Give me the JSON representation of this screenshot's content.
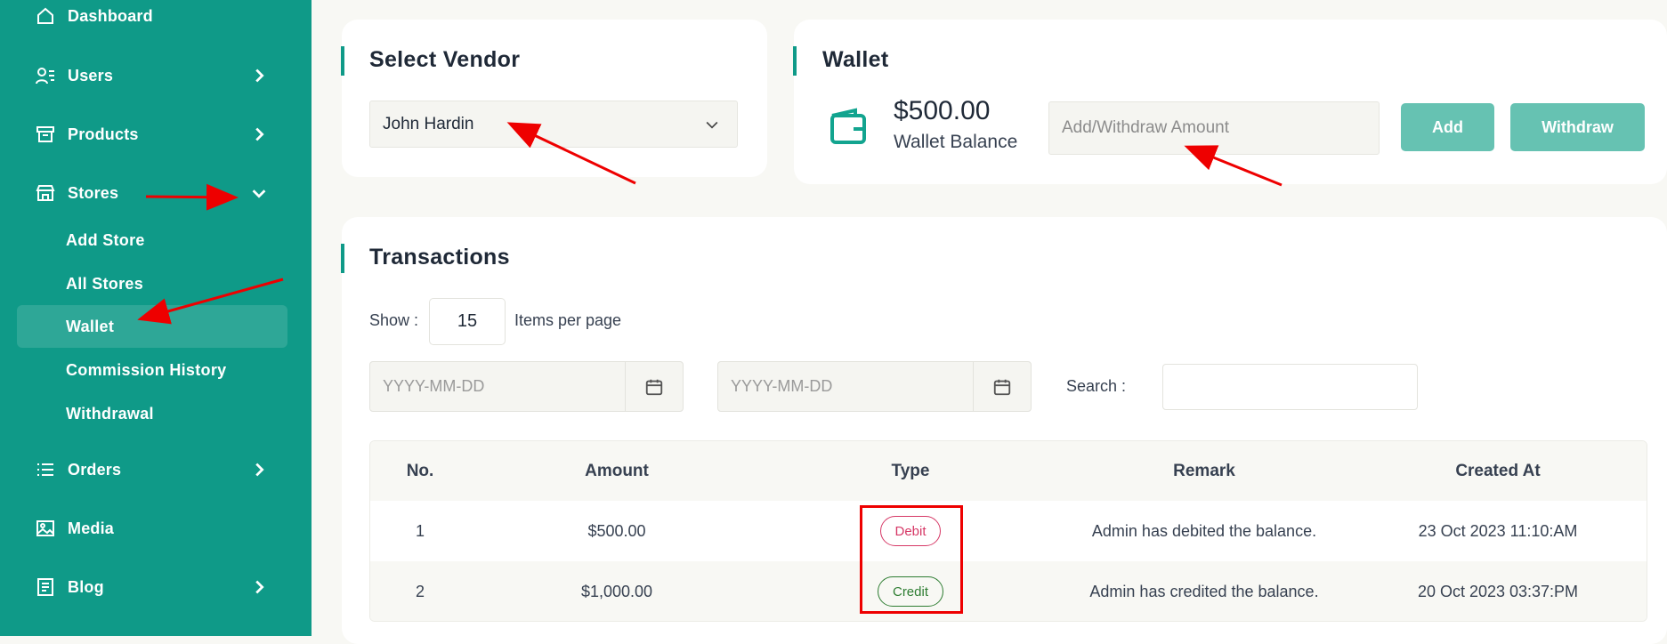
{
  "sidebar": {
    "items": [
      {
        "label": "Dashboard",
        "icon": "home-icon"
      },
      {
        "label": "Users",
        "icon": "users-icon"
      },
      {
        "label": "Products",
        "icon": "products-icon"
      },
      {
        "label": "Stores",
        "icon": "store-icon"
      },
      {
        "label": "Orders",
        "icon": "list-icon"
      },
      {
        "label": "Media",
        "icon": "image-icon"
      },
      {
        "label": "Blog",
        "icon": "blog-icon"
      }
    ],
    "stores_submenu": [
      "Add Store",
      "All Stores",
      "Wallet",
      "Commission History",
      "Withdrawal"
    ],
    "active_subitem": "Wallet"
  },
  "vendor": {
    "title": "Select Vendor",
    "selected": "John Hardin"
  },
  "wallet": {
    "title": "Wallet",
    "balance": "$500.00",
    "balance_label": "Wallet Balance",
    "amount_placeholder": "Add/Withdraw Amount",
    "add_label": "Add",
    "withdraw_label": "Withdraw"
  },
  "transactions": {
    "title": "Transactions",
    "show_label": "Show :",
    "per_page": "15",
    "items_label": "Items per page",
    "date_from_placeholder": "YYYY-MM-DD",
    "date_to_placeholder": "YYYY-MM-DD",
    "search_label": "Search :",
    "columns": [
      "No.",
      "Amount",
      "Type",
      "Remark",
      "Created At"
    ],
    "rows": [
      {
        "no": "1",
        "amount": "$500.00",
        "type": "Debit",
        "remark": "Admin has debited the balance.",
        "created_at": "23 Oct 2023 11:10:AM"
      },
      {
        "no": "2",
        "amount": "$1,000.00",
        "type": "Credit",
        "remark": "Admin has credited the balance.",
        "created_at": "20 Oct 2023 03:37:PM"
      }
    ]
  },
  "colors": {
    "brand": "#0f9a88",
    "button": "#66c2b2",
    "debit": "#d63866",
    "credit": "#2e7d32",
    "annotation": "#e00000"
  }
}
